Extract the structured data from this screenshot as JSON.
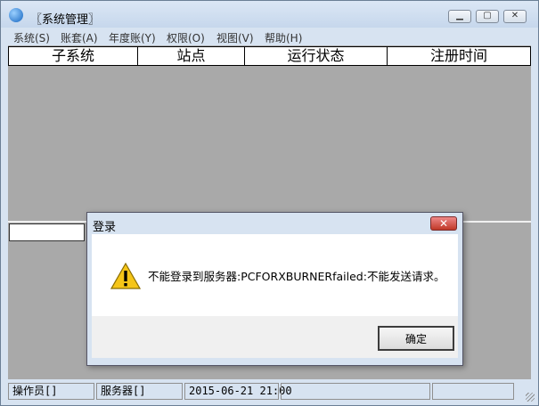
{
  "window": {
    "title": "〖系统管理〗",
    "minimize_glyph": "▁",
    "maximize_glyph": "▢",
    "close_glyph": "✕"
  },
  "menu": [
    {
      "label": "系统(S)"
    },
    {
      "label": "账套(A)"
    },
    {
      "label": "年度账(Y)"
    },
    {
      "label": "权限(O)"
    },
    {
      "label": "视图(V)"
    },
    {
      "label": "帮助(H)"
    }
  ],
  "grid": {
    "columns": [
      "子系统",
      "站点",
      "运行状态",
      "注册时间"
    ]
  },
  "dialog": {
    "title": "登录",
    "close_glyph": "✕",
    "message": "不能登录到服务器:PCFORXBURNERfailed:不能发送请求。",
    "ok_label": "确定",
    "close_color": "#c9382b"
  },
  "statusbar": {
    "operator": "操作员[]",
    "server": "服务器[]",
    "datetime": "2015-06-21 21:00"
  },
  "icons": [
    "app-icon",
    "warning-icon",
    "resize-grip-icon"
  ]
}
